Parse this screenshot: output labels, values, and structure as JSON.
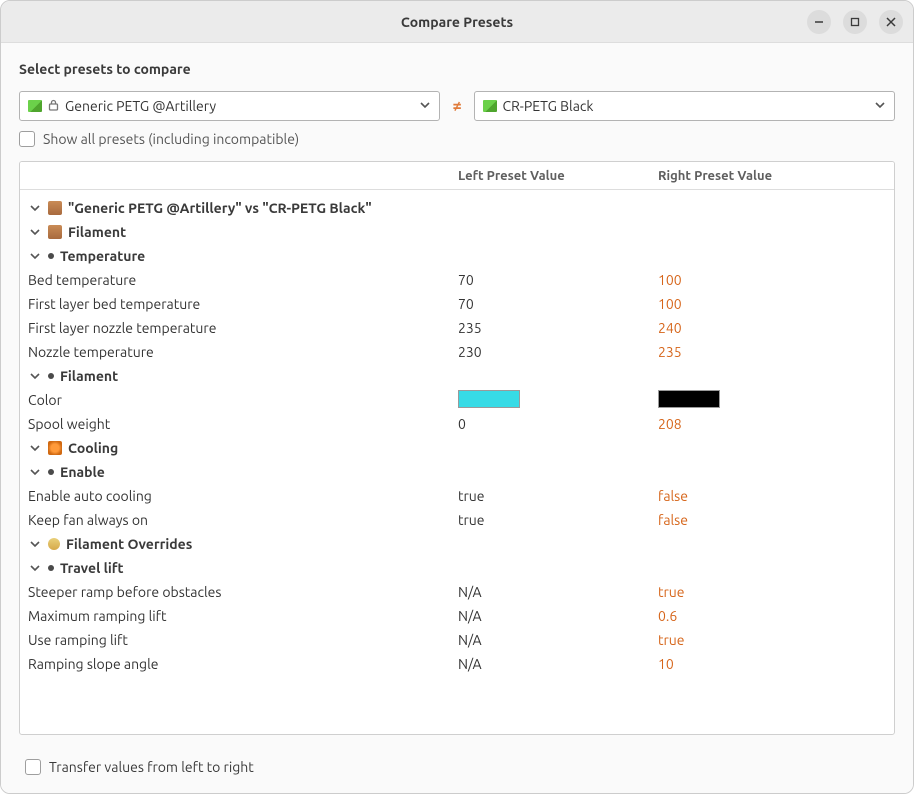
{
  "window": {
    "title": "Compare Presets"
  },
  "select_label": "Select presets to compare",
  "left_preset": {
    "label": "Generic PETG @Artillery",
    "locked": true
  },
  "right_preset": {
    "label": "CR-PETG Black",
    "locked": false
  },
  "show_all": {
    "label": "Show all presets (including incompatible)"
  },
  "headers": {
    "left": "Left Preset Value",
    "right": "Right Preset Value"
  },
  "root_label": "\"Generic PETG @Artillery\" vs \"CR-PETG Black\"",
  "groups": {
    "filament": {
      "label": "Filament",
      "temperature": {
        "label": "Temperature",
        "bed_temp": {
          "label": "Bed temperature",
          "left": "70",
          "right": "100"
        },
        "first_bed": {
          "label": "First layer bed temperature",
          "left": "70",
          "right": "100"
        },
        "first_nozzle": {
          "label": "First layer nozzle temperature",
          "left": "235",
          "right": "240"
        },
        "nozzle": {
          "label": "Nozzle temperature",
          "left": "230",
          "right": "235"
        }
      },
      "filament_sub": {
        "label": "Filament",
        "color": {
          "label": "Color",
          "left": "#37dbe6",
          "right": "#000000"
        },
        "spool": {
          "label": "Spool weight",
          "left": "0",
          "right": "208"
        }
      }
    },
    "cooling": {
      "label": "Cooling",
      "enable": {
        "label": "Enable",
        "auto": {
          "label": "Enable auto cooling",
          "left": "true",
          "right": "false"
        },
        "fan": {
          "label": "Keep fan always on",
          "left": "true",
          "right": "false"
        }
      }
    },
    "overrides": {
      "label": "Filament Overrides",
      "travel": {
        "label": "Travel lift",
        "steeper": {
          "label": "Steeper ramp before obstacles",
          "left": "N/A",
          "right": "true"
        },
        "maxlift": {
          "label": "Maximum ramping lift",
          "left": "N/A",
          "right": "0.6"
        },
        "useramp": {
          "label": "Use ramping lift",
          "left": "N/A",
          "right": "true"
        },
        "slope": {
          "label": "Ramping slope angle",
          "left": "N/A",
          "right": "10"
        }
      }
    }
  },
  "transfer": {
    "label": "Transfer values from left to right"
  }
}
